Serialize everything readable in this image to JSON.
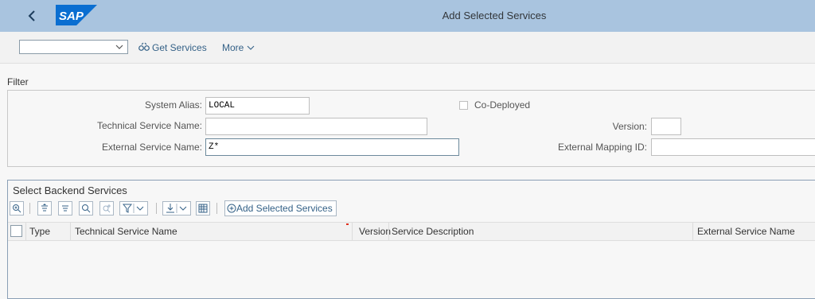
{
  "shell": {
    "title": "Add Selected Services",
    "back_icon": "chevron-left-icon",
    "logo_text": "SAP",
    "logo_color": "#0a6ed1"
  },
  "toolbar": {
    "dropdown_value": "",
    "get_services_label": "Get Services",
    "get_services_icon": "binoculars-icon",
    "more_label": "More"
  },
  "filter": {
    "title": "Filter",
    "system_alias_label": "System Alias:",
    "system_alias_value": "LOCAL",
    "co_deployed_label": "Co-Deployed",
    "technical_service_name_label": "Technical Service Name:",
    "technical_service_name_value": "",
    "version_label": "Version:",
    "version_value": "",
    "external_service_name_label": "External Service Name:",
    "external_service_name_value": "Z*",
    "external_mapping_id_label": "External Mapping ID:",
    "external_mapping_id_value": ""
  },
  "backend": {
    "title": "Select Backend Services",
    "add_selected_label": "Add Selected Services",
    "columns": [
      "Type",
      "Technical Service Name",
      "Version",
      "Service Description",
      "External Service Name"
    ]
  },
  "colors": {
    "shell_bg": "#a9c4df",
    "link": "#346187"
  }
}
